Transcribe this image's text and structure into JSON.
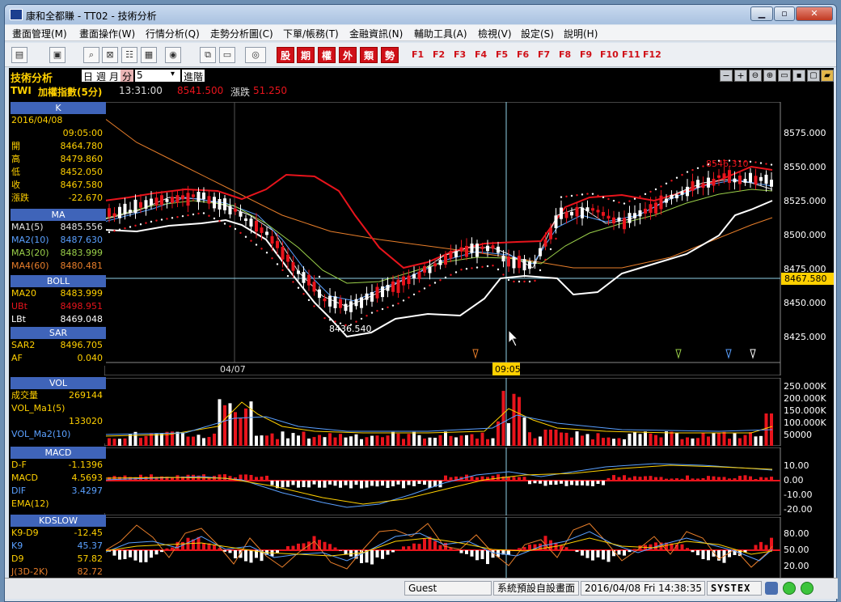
{
  "window": {
    "title": "康和全都賺 - TT02 - 技術分析",
    "min_label": "▁",
    "max_label": "▫",
    "close_label": "✕"
  },
  "menu": [
    "畫面管理(M)",
    "畫面操作(W)",
    "行情分析(Q)",
    "走勢分析圖(C)",
    "下單/帳務(T)",
    "金融資訊(N)",
    "輔助工具(A)",
    "檢視(V)",
    "設定(S)",
    "說明(H)"
  ],
  "toolbar": {
    "red_buttons": [
      "股",
      "期",
      "權",
      "外",
      "類",
      "勢"
    ],
    "fkeys": [
      "F1",
      "F2",
      "F3",
      "F4",
      "F5",
      "F6",
      "F7",
      "F8",
      "F9",
      "F10",
      "F11",
      "F12"
    ]
  },
  "header": {
    "section": "技術分析",
    "periods": [
      "日",
      "週",
      "月",
      "分"
    ],
    "active_period": "分",
    "interval": "5",
    "advanced": "進階",
    "symbol": "TWI",
    "symbol_name": "加權指數(5分)",
    "time": "13:31:00",
    "price": "8541.500",
    "change_label": "漲跌",
    "change": "51.250"
  },
  "left_panels": {
    "k": {
      "title": "K",
      "date": "2016/04/08",
      "time": "09:05:00",
      "rows": [
        {
          "k": "開",
          "v": "8464.780"
        },
        {
          "k": "高",
          "v": "8479.860"
        },
        {
          "k": "低",
          "v": "8452.050"
        },
        {
          "k": "收",
          "v": "8467.580"
        },
        {
          "k": "漲跌",
          "v": "-22.670"
        }
      ]
    },
    "ma": {
      "title": "MA",
      "rows": [
        {
          "k": "MA1(5)",
          "v": "8485.556"
        },
        {
          "k": "MA2(10)",
          "v": "8487.630"
        },
        {
          "k": "MA3(20)",
          "v": "8483.999"
        },
        {
          "k": "MA4(60)",
          "v": "8480.481"
        }
      ]
    },
    "boll": {
      "title": "BOLL",
      "rows": [
        {
          "k": "MA20",
          "v": "8483.999"
        },
        {
          "k": "UBt",
          "v": "8498.951"
        },
        {
          "k": "LBt",
          "v": "8469.048"
        }
      ]
    },
    "sar": {
      "title": "SAR",
      "rows": [
        {
          "k": "SAR2",
          "v": "8496.705"
        },
        {
          "k": "AF",
          "v": "0.040"
        }
      ]
    },
    "vol": {
      "title": "VOL",
      "rows": [
        {
          "k": "成交量",
          "v": "269144"
        },
        {
          "k": "VOL_Ma1(5)",
          "v": ""
        },
        {
          "k": "",
          "v": "133020"
        },
        {
          "k": "VOL_Ma2(10)",
          "v": ""
        }
      ]
    },
    "macd": {
      "title": "MACD",
      "rows": [
        {
          "k": "D-F",
          "v": "-1.1396"
        },
        {
          "k": "MACD",
          "v": "4.5693"
        },
        {
          "k": "DIF",
          "v": "3.4297"
        },
        {
          "k": "EMA(12)",
          "v": ""
        }
      ]
    },
    "kd": {
      "title": "KDSLOW",
      "rows": [
        {
          "k": "K9-D9",
          "v": "-12.45"
        },
        {
          "k": "K9",
          "v": "45.37"
        },
        {
          "k": "D9",
          "v": "57.82"
        },
        {
          "k": "J(3D-2K)",
          "v": "82.72"
        }
      ]
    }
  },
  "chart_labels": {
    "price_ticks": [
      "8575.000",
      "8550.000",
      "8525.000",
      "8500.000",
      "8475.000",
      "8450.000",
      "8425.000"
    ],
    "current_price_tag": "8467.580",
    "high_label": "8546.310",
    "low_label": "8436.540",
    "date_label": "04/07",
    "cursor_time": "09:05",
    "vol_ticks": [
      "250.000K",
      "200.000K",
      "150.000K",
      "100.000K",
      "50000"
    ],
    "macd_ticks": [
      "10.00",
      "0.00",
      "-10.00",
      "-20.00"
    ],
    "kd_ticks": [
      "80.00",
      "50.00",
      "20.00"
    ]
  },
  "status": {
    "user": "Guest",
    "layout": "系統預設自設畫面",
    "datetime": "2016/04/08 Fri 14:38:35",
    "brand": "SYSTEX"
  },
  "colors": {
    "up": "#e8141c",
    "down": "#ffffff",
    "accent": "#ffd000",
    "panel_header": "#3f64b9"
  }
}
